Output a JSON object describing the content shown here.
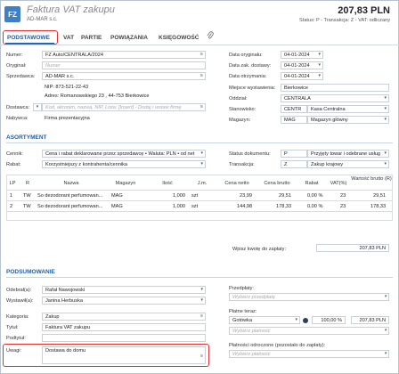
{
  "header": {
    "logo": "FZ",
    "title": "Faktura VAT zakupu",
    "subtitle": "AD-MAR s.c.",
    "total": "207,83 PLN",
    "status": "Status: P - Transakcja: Z - VAT: odliczany"
  },
  "tabs": [
    "PODSTAWOWE",
    "VAT",
    "PARTIE",
    "POWIĄZANIA",
    "KSIĘGOWOŚĆ"
  ],
  "left": {
    "numer_label": "Numer:",
    "numer": "FZ Auto/CENTRALA/2024",
    "oryginal_label": "Oryginał:",
    "oryginal_placeholder": "Numer",
    "sprzedawca_label": "Sprzedawca:",
    "sprzedawca": "AD-MAR s.c.",
    "nip": "NIP: 873-521-22-43",
    "adres": "Adres: Romanowskiego 23 , 44-753 Bierkowice",
    "dostawca_label": "Dostawca:",
    "dostawca_placeholder": "Kod, akronim, nazwa, NIP, Lista: [Insert] - Dodaj i wstaw firmę",
    "nabywca_label": "Nabywca:",
    "nabywca": "Firma prezentacyjna"
  },
  "right": {
    "data_oryg_label": "Data oryginału:",
    "data_oryg": "04-01-2024",
    "data_zak_label": "Data zak. dostawy:",
    "data_zak": "04-01-2024",
    "data_otrz_label": "Data otrzymania:",
    "data_otrz": "04-01-2024",
    "miejsce_label": "Miejsce wystawienia:",
    "miejsce": "Bierkowice",
    "oddzial_label": "Oddział:",
    "oddzial": "CENTRALA",
    "stanowisko_label": "Stanowisko:",
    "stanowisko_code": "CENTR",
    "stanowisko": "Kasa Centralna",
    "magazyn_label": "Magazyn:",
    "magazyn_code": "MAG",
    "magazyn": "Magazyn główny"
  },
  "asortyment": {
    "title": "ASORTYMENT",
    "cennik_label": "Cennik:",
    "cennik": "Cena i rabat deklarowane przez sprzedawcę • Waluta: PLN • od net",
    "rabat_label": "Rabat:",
    "rabat": "Korzystniejszy z kontrahenta/cennika",
    "status_dok_label": "Status dokumentu:",
    "status_code": "P",
    "status": "Przyjęty towar i odebrane usług",
    "transakcja_label": "Transakcja:",
    "transakcja_code": "Z",
    "transakcja": "Zakup krajowy",
    "columns": [
      "LP",
      "R",
      "Nazwa",
      "Magazyn",
      "Ilość",
      "J.m.",
      "Cena netto",
      "Cena brutto",
      "Rabat",
      "VAT(%)",
      "Wartość brutto (R)"
    ],
    "rows": [
      [
        "1",
        "TW",
        "So dezodorant perfumowan...",
        "MAG",
        "1,000",
        "szt",
        "23,99",
        "29,51",
        "0,00 %",
        "23",
        "29,51"
      ],
      [
        "2",
        "TW",
        "So dezodorant perfumowan...",
        "MAG",
        "1,000",
        "szt",
        "144,98",
        "178,33",
        "0,00 %",
        "23",
        "178,33"
      ]
    ],
    "wpisz_label": "Wpisz kwotę do zapłaty:",
    "wpisz_value": "207,83 PLN"
  },
  "podsumowanie": {
    "title": "PODSUMOWANIE",
    "odebral_label": "Odebrał(a):",
    "odebral": "Rafał Nawojowski",
    "wystawil_label": "Wystawił(a):",
    "wystawil": "Janina Herbuska",
    "kategoria_label": "Kategoria:",
    "kategoria": "Zakup",
    "tytul_label": "Tytuł:",
    "tytul": "Faktura VAT zakupu",
    "podtytul_label": "Podtytuł:",
    "uwagi_label": "Uwagi:",
    "uwagi": "Dostawa do domu",
    "przedplaty_label": "Przedpłaty:",
    "przedplaty_placeholder": "Wybierz przedpłatę",
    "platne_label": "Płatne teraz:",
    "platne_method": "Gotówka",
    "platne_percent": "100,00 %",
    "platne_amount": "207,83 PLN",
    "platne_placeholder": "Wybierz płatność",
    "odroczone_label": "Płatności odroczone (pozostało do zapłaty):",
    "odroczone_placeholder": "Wybierz płatność"
  }
}
